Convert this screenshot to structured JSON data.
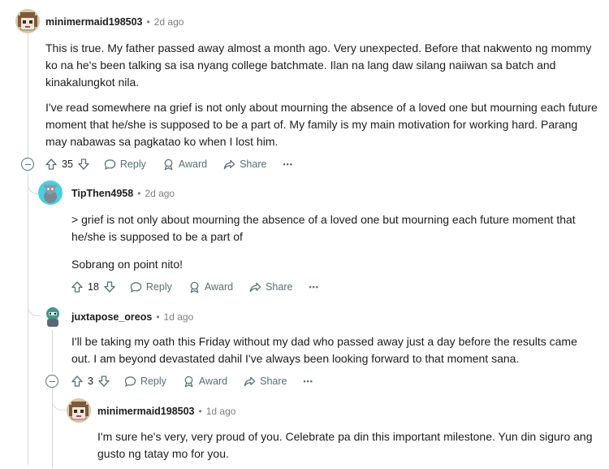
{
  "comments": [
    {
      "username": "minimermaid198503",
      "separator": "•",
      "time": "2d ago",
      "paragraphs": [
        "This is true. My father passed away almost a month ago. Very unexpected. Before that nakwento ng mommy ko na he's been talking sa isa nyang college batchmate. Ilan na lang daw silang naiiwan sa batch and kinakalungkot nila.",
        "I've read somewhere na grief is not only about mourning the absence of a loved one but mourning each future moment that he/she is supposed to be a part of. My family is my main motivation for working hard. Parang may nabawas sa pagkatao ko when I lost him."
      ],
      "votes": "35",
      "reply_label": "Reply",
      "award_label": "Award",
      "share_label": "Share",
      "more_label": "•••"
    },
    {
      "username": "TipThen4958",
      "separator": "•",
      "time": "2d ago",
      "paragraphs": [
        "> grief is not only about mourning the absence of a loved one but mourning each future moment that he/she is supposed to be a part of",
        "Sobrang on point nito!"
      ],
      "votes": "18",
      "reply_label": "Reply",
      "award_label": "Award",
      "share_label": "Share",
      "more_label": "•••"
    },
    {
      "username": "juxtapose_oreos",
      "separator": "•",
      "time": "1d ago",
      "paragraphs": [
        "I'll be taking my oath this Friday without my dad who passed away just a day before the results came out. I am beyond devastated dahil I've always been looking forward to that moment sana."
      ],
      "votes": "3",
      "reply_label": "Reply",
      "award_label": "Award",
      "share_label": "Share",
      "more_label": "•••"
    },
    {
      "username": "minimermaid198503",
      "separator": "•",
      "time": "1d ago",
      "paragraphs": [
        "I'm sure he's very, very proud of you. Celebrate pa din this important milestone. Yun din siguro ang gusto ng tatay mo for you."
      ]
    }
  ]
}
